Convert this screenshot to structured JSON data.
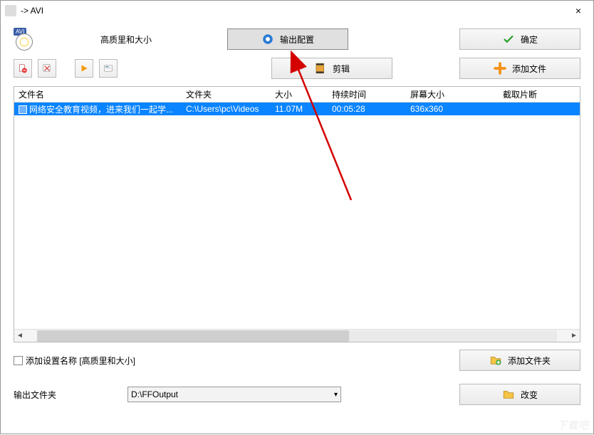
{
  "titlebar": {
    "title": "  -> AVI",
    "close": "×"
  },
  "top": {
    "quality_label": "高质里和大小",
    "output_config": "输出配置",
    "ok": "确定"
  },
  "tools": {
    "clip": "剪辑",
    "add_file": "添加文件"
  },
  "table": {
    "columns": [
      "文件名",
      "文件夹",
      "大小",
      "持续时间",
      "屏幕大小",
      "截取片断"
    ],
    "rows": [
      {
        "filename": "网络安全教育视频，进来我们一起学...",
        "folder": "C:\\Users\\pc\\Videos",
        "size": "11.07M",
        "duration": "00:05:28",
        "dimensions": "636x360",
        "clip": ""
      }
    ]
  },
  "bottom": {
    "settings_label": "添加设置名称 [高质里和大小]",
    "add_folder": "添加文件夹",
    "output_folder_label": "输出文件夹",
    "output_folder_value": "D:\\FFOutput",
    "change": "改变"
  },
  "watermark": "下载吧"
}
